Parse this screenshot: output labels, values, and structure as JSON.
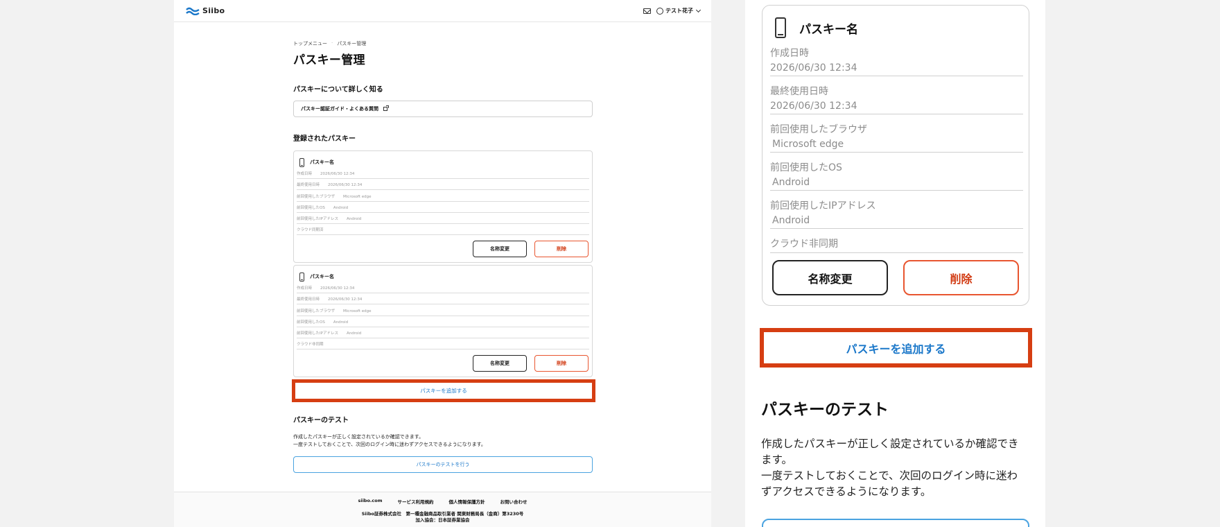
{
  "brand": {
    "name": "Siibo"
  },
  "header": {
    "user_name": "テスト花子"
  },
  "breadcrumb": [
    "トップメニュー",
    "パスキー管理"
  ],
  "page_title": "パスキー管理",
  "learn": {
    "heading": "パスキーについて詳しく知る",
    "guide_link": "パスキー認証ガイド・よくある質問"
  },
  "registered": {
    "heading": "登録されたパスキー",
    "cards": [
      {
        "name": "パスキー名",
        "rows": [
          {
            "label": "作成日時",
            "value": "2026/06/30 12:34"
          },
          {
            "label": "最終使用日時",
            "value": "2026/06/30 12:34"
          },
          {
            "label": "前回使用したブラウザ",
            "value": "Microsoft edge"
          },
          {
            "label": "前回使用したOS",
            "value": "Android"
          },
          {
            "label": "前回使用したIPアドレス",
            "value": "Android"
          },
          {
            "label": "クラウド同期済",
            "value": ""
          }
        ],
        "rename_label": "名称変更",
        "delete_label": "削除"
      },
      {
        "name": "パスキー名",
        "rows": [
          {
            "label": "作成日時",
            "value": "2026/06/30 12:34"
          },
          {
            "label": "最終使用日時",
            "value": "2026/06/30 12:34"
          },
          {
            "label": "前回使用したブラウザ",
            "value": "Microsoft edge"
          },
          {
            "label": "前回使用したOS",
            "value": "Android"
          },
          {
            "label": "前回使用したIPアドレス",
            "value": "Android"
          },
          {
            "label": "クラウド非同期",
            "value": ""
          }
        ],
        "rename_label": "名称変更",
        "delete_label": "削除"
      }
    ],
    "add_label": "パスキーを追加する"
  },
  "test": {
    "heading": "パスキーのテスト",
    "desc_line1": "作成したパスキーが正しく設定されているか確認できます。",
    "desc_line2": "一度テストしておくことで、次回のログイン時に迷わずアクセスできるようになります。",
    "button_label": "パスキーのテストを行う"
  },
  "footer": {
    "links": [
      "siibo.com",
      "サービス利用規約",
      "個人情報保護方針",
      "お問い合わせ"
    ],
    "company_line1": "Siibo証券株式会社　第一種金融商品取引業者 関東財務局長（金商）第3230号",
    "company_line2": "加入協会：日本証券業協会"
  },
  "zoom": {
    "name": "パスキー名",
    "rows": [
      {
        "label": "作成日時",
        "value": "2026/06/30 12:34"
      },
      {
        "label": "最終使用日時",
        "value": "2026/06/30 12:34"
      },
      {
        "label": "前回使用したブラウザ",
        "value": "Microsoft edge"
      },
      {
        "label": "前回使用したOS",
        "value": "Android"
      },
      {
        "label": "前回使用したIPアドレス",
        "value": "Android"
      },
      {
        "label": "クラウド非同期",
        "value": ""
      }
    ],
    "rename_label": "名称変更",
    "delete_label": "削除",
    "add_label": "パスキーを追加する",
    "test_heading": "パスキーのテスト",
    "desc_line1": "作成したパスキーが正しく設定されているか確認できます。",
    "desc_line2": "一度テストしておくことで、次回のログイン時に迷わずアクセスできるようになります。"
  },
  "colors": {
    "accent_red": "#d63e12",
    "link_blue": "#1a77c9",
    "delete_red": "#d13a12"
  }
}
